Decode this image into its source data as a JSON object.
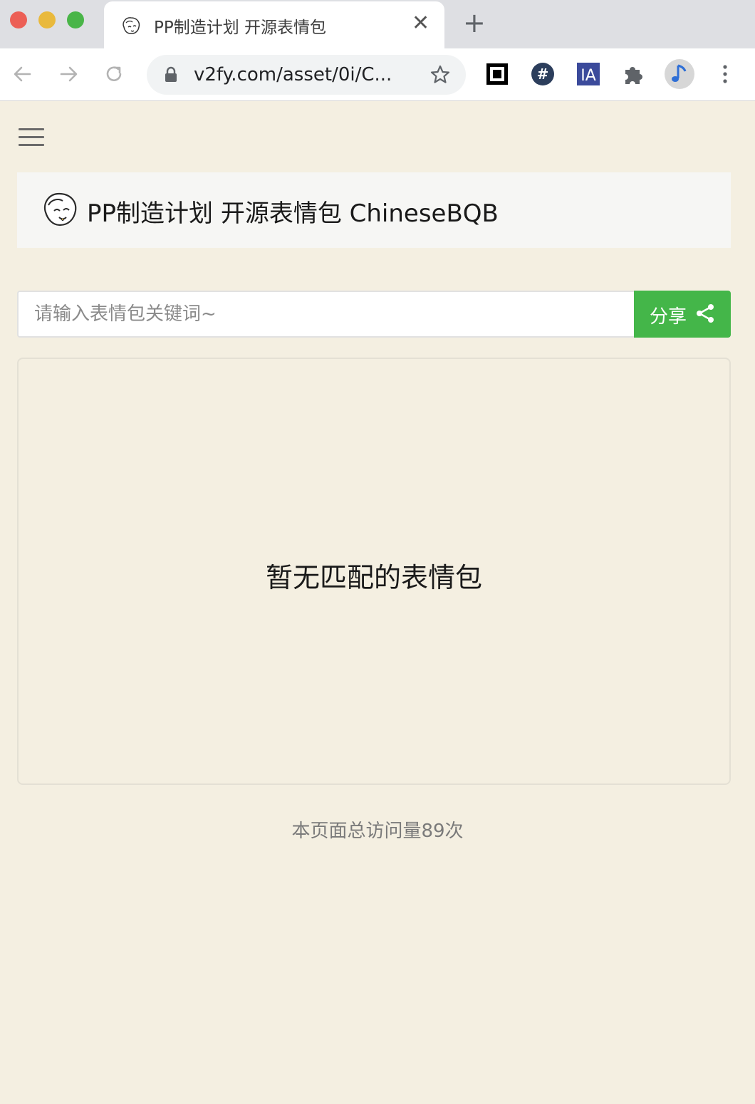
{
  "browser": {
    "tab_title": "PP制造计划 开源表情包",
    "tab_close": "✕",
    "new_tab": "+",
    "url": "v2fy.com/asset/0i/C...",
    "extensions": [
      "qr-code-icon",
      "hashtag-icon",
      "ia-icon",
      "puzzle-icon",
      "music-note-icon"
    ],
    "ia_label": "IA",
    "hash_label": "#"
  },
  "header": {
    "title": "PP制造计划 开源表情包 ChineseBQB"
  },
  "search": {
    "placeholder": "请输入表情包关键词~",
    "value": "",
    "share_label": "分享"
  },
  "results": {
    "empty_message": "暂无匹配的表情包"
  },
  "footer": {
    "visit_text": "本页面总访问量89次"
  },
  "colors": {
    "page_bg": "#f4efe1",
    "share_button": "#44b649",
    "tab_bar": "#dedfe3"
  }
}
